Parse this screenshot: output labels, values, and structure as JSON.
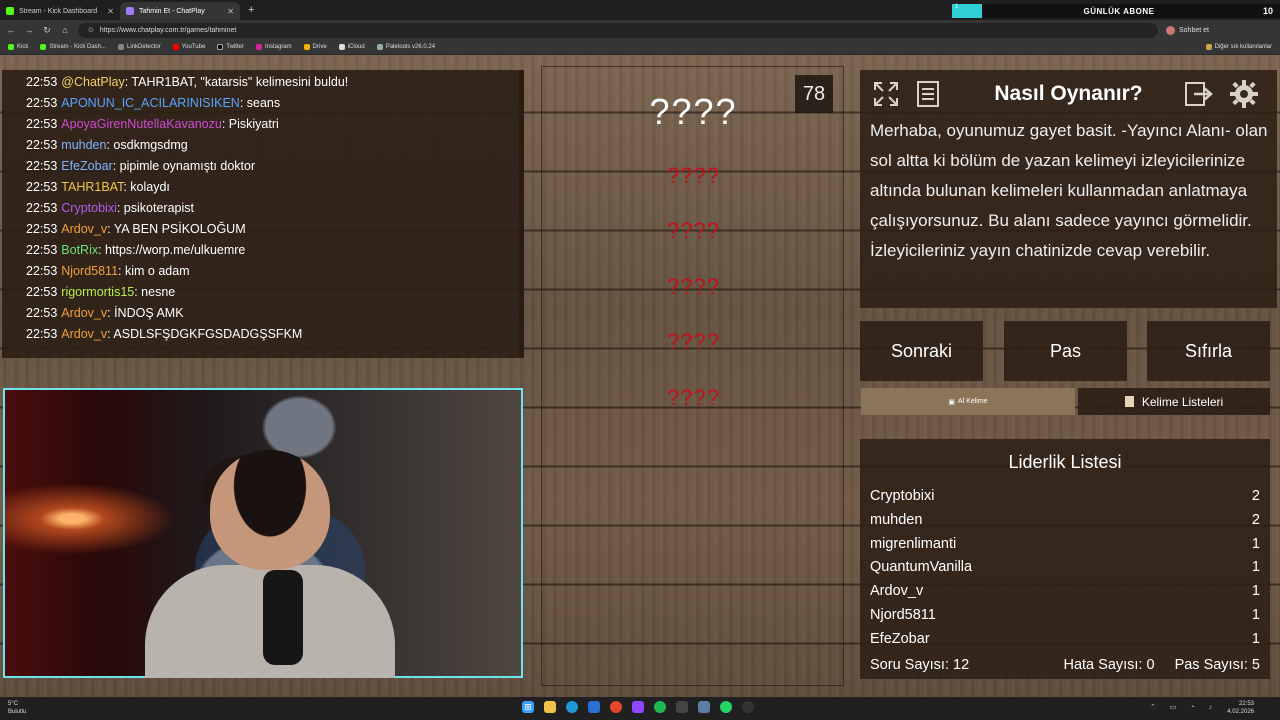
{
  "browser": {
    "tabs": [
      {
        "title": "Stream - Kick Dashboard",
        "active": false
      },
      {
        "title": "Tahmin Et - ChatPlay",
        "active": true
      }
    ],
    "new_tab": "+",
    "url": "https://www.chatplay.com.tr/games/tahminet",
    "profile_label": "Sohbet et",
    "bookmarks": [
      "Kick",
      "Stream - Kick Dash...",
      "LinkDetector",
      "YouTube",
      "Twitter",
      "Instagram",
      "Drive",
      "iCloud",
      "Paletools v26.0.24"
    ],
    "bookmarks_right": "Diğer sık kullanılanlar"
  },
  "subscriber_goal": {
    "label": "GÜNLÜK ABONE",
    "current": "1",
    "target": "10",
    "progress": 0.1
  },
  "chat": {
    "messages": [
      {
        "time": "22:53",
        "user": "@ChatPlay",
        "color": "#f2d26b",
        "text": ": TAHR1BAT, \"katarsis\" kelimesini buldu!"
      },
      {
        "time": "22:53",
        "user": "APONUN_IC_ACILARINISIKEN",
        "color": "#5aa3ff",
        "text": ": seans"
      },
      {
        "time": "22:53",
        "user": "ApoyaGirenNutellaKavanozu",
        "color": "#d04bd6",
        "text": ": Piskiyatri"
      },
      {
        "time": "22:53",
        "user": "muhden",
        "color": "#7fb4ff",
        "text": ": osdkmgsdmg"
      },
      {
        "time": "22:53",
        "user": "EfeZobar",
        "color": "#7fb4ff",
        "text": ": pipimle oynamıştı doktor"
      },
      {
        "time": "22:53",
        "user": "TAHR1BAT",
        "color": "#f0c64a",
        "text": ": kolaydı"
      },
      {
        "time": "22:53",
        "user": "Cryptobixi",
        "color": "#b35cf0",
        "text": ": psikoterapist"
      },
      {
        "time": "22:53",
        "user": "Ardov_v",
        "color": "#f0a13a",
        "text": ": YA BEN PSİKOLOĞUM"
      },
      {
        "time": "22:53",
        "user": "BotRix",
        "color": "#6fe07a",
        "text": ": https://worp.me/ulkuemre"
      },
      {
        "time": "22:53",
        "user": "Njord5811",
        "color": "#f0a13a",
        "text": ": kim o adam"
      },
      {
        "time": "22:53",
        "user": "rigormortis15",
        "color": "#b6f04a",
        "text": ": nesne"
      },
      {
        "time": "22:53",
        "user": "Ardov_v",
        "color": "#f0a13a",
        "text": ": İNDOŞ AMK"
      },
      {
        "time": "22:53",
        "user": "Ardov_v",
        "color": "#f0a13a",
        "text": ": ASDLSFŞDGKFGSDADGŞSFKM"
      }
    ]
  },
  "board": {
    "score": "78",
    "main_word": "????",
    "forbidden_words": [
      "????",
      "????",
      "????",
      "????",
      "????"
    ]
  },
  "howto": {
    "title": "Nasıl Oynanır?",
    "text": "Merhaba, oyunumuz gayet basit. -Yayıncı Alanı- olan sol altta ki bölüm de yazan kelimeyi izleyicilerinize altında bulunan kelimeleri kullanmadan anlatmaya çalışıyorsunuz. Bu alanı sadece yayıncı görmelidir. İzleyicileriniz yayın chatinizde cevap verebilir."
  },
  "controls": {
    "next": "Sonraki",
    "pass": "Pas",
    "reset": "Sıfırla",
    "ai_word": "Al Kelime",
    "word_lists": "Kelime Listeleri"
  },
  "leaderboard": {
    "title": "Liderlik Listesi",
    "rows": [
      {
        "name": "Cryptobixi",
        "score": "2"
      },
      {
        "name": "muhden",
        "score": "2"
      },
      {
        "name": "migrenlimanti",
        "score": "1"
      },
      {
        "name": "QuantumVanilla",
        "score": "1"
      },
      {
        "name": "Ardov_v",
        "score": "1"
      },
      {
        "name": "Njord5811",
        "score": "1"
      },
      {
        "name": "EfeZobar",
        "score": "1"
      }
    ],
    "question_count": "Soru Sayısı: 12",
    "error_count": "Hata Sayısı: 0",
    "pass_count": "Pas Sayısı: 5"
  },
  "taskbar": {
    "weather_temp": "5°C",
    "weather_desc": "Bulutlu",
    "time": "22:53",
    "date": "4.02.2026"
  }
}
